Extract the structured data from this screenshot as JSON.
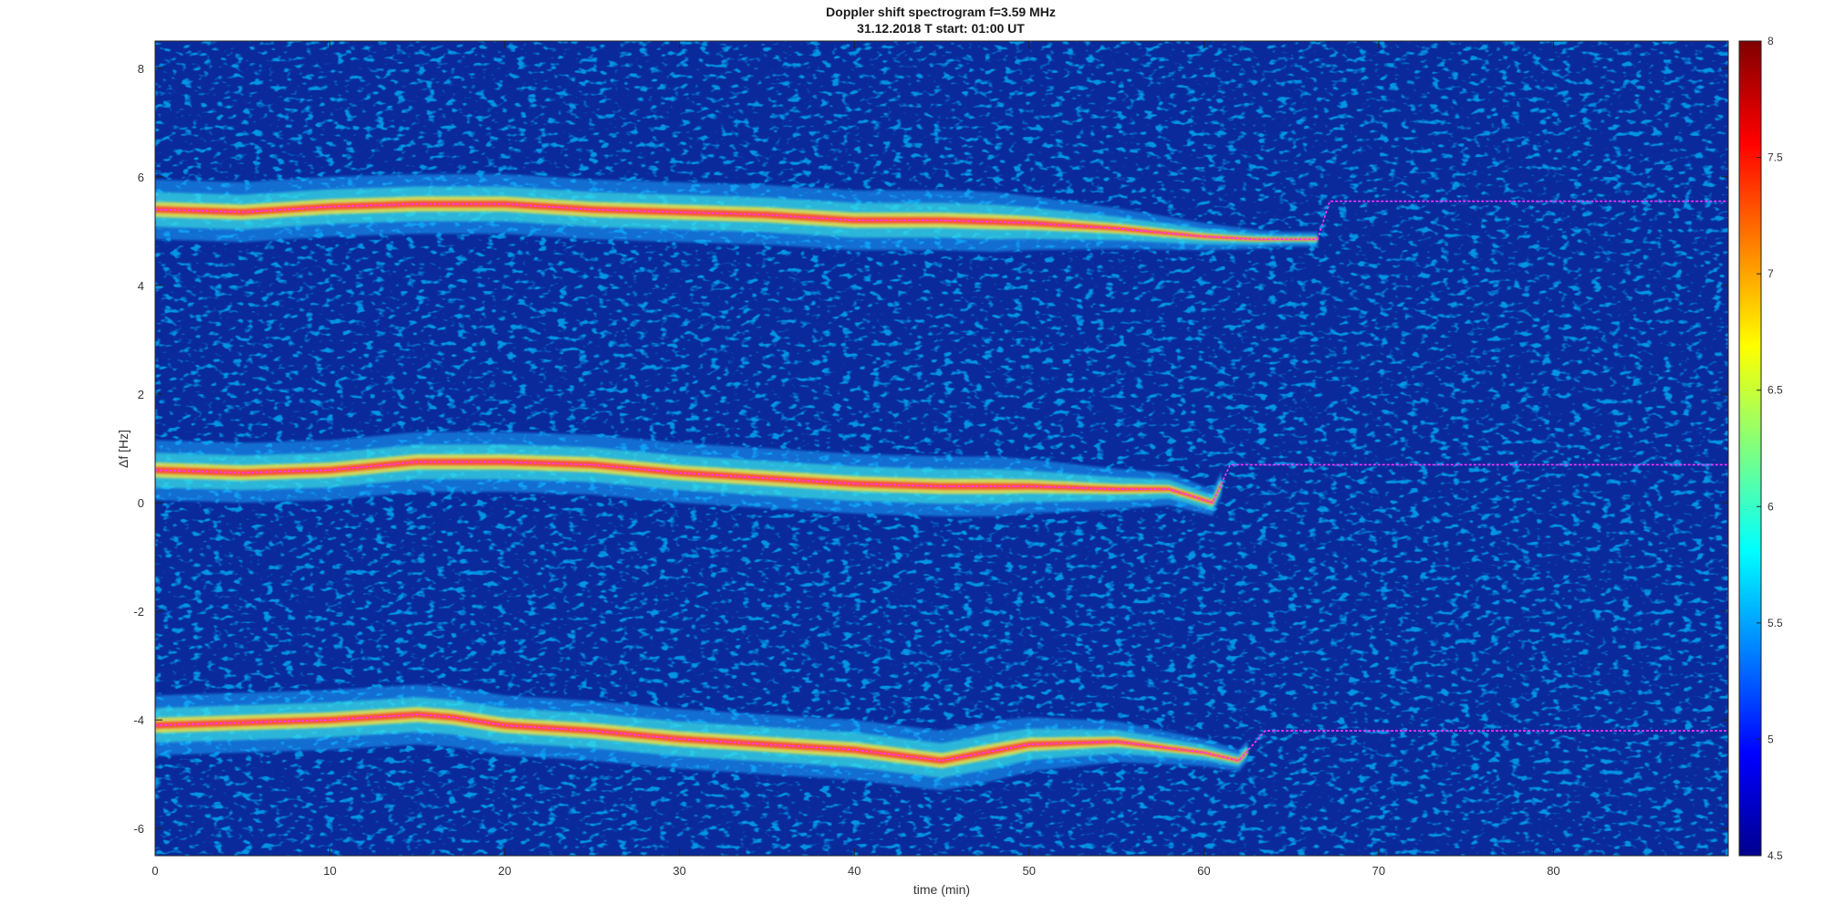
{
  "colors": {
    "background": "#ffffff",
    "plot_background": "#0a2a9c",
    "track_color": "#ff33ff",
    "marker_color": "#000000",
    "colormap": "jet"
  },
  "chart_data": {
    "type": "heatmap",
    "title": "Doppler shift spectrogram f=3.59 MHz",
    "subtitle": "31.12.2018   T start: 01:00 UT",
    "xlabel": "time (min)",
    "ylabel": "Δf [Hz]",
    "xlim": [
      0,
      90
    ],
    "ylim": [
      -6.5,
      8.5
    ],
    "xticks": [
      0,
      10,
      20,
      30,
      40,
      50,
      60,
      70,
      80
    ],
    "yticks": [
      -6,
      -4,
      -2,
      0,
      2,
      4,
      6,
      8
    ],
    "colorbar": {
      "range": [
        4.5,
        8
      ],
      "ticks": [
        4.5,
        5,
        5.5,
        6,
        6.5,
        7,
        7.5,
        8
      ]
    },
    "grid": false,
    "series": [
      {
        "band": "upper",
        "x": [
          0,
          5,
          10,
          15,
          20,
          25,
          30,
          35,
          40,
          45,
          50,
          55,
          60,
          63,
          66.5,
          67.2,
          90
        ],
        "y": [
          5.4,
          5.35,
          5.45,
          5.5,
          5.5,
          5.4,
          5.35,
          5.3,
          5.2,
          5.2,
          5.15,
          5.05,
          4.9,
          4.85,
          4.85,
          5.55,
          5.55
        ]
      },
      {
        "band": "middle",
        "x": [
          0,
          5,
          10,
          15,
          20,
          25,
          30,
          35,
          40,
          45,
          50,
          55,
          58,
          60.5,
          61.5,
          90
        ],
        "y": [
          0.6,
          0.55,
          0.6,
          0.75,
          0.75,
          0.7,
          0.55,
          0.45,
          0.35,
          0.3,
          0.3,
          0.25,
          0.25,
          0.0,
          0.7,
          0.7
        ]
      },
      {
        "band": "lower",
        "x": [
          0,
          5,
          10,
          15,
          17,
          20,
          25,
          30,
          35,
          40,
          45,
          50,
          55,
          60,
          62,
          63.5,
          90
        ],
        "y": [
          -4.1,
          -4.05,
          -4.0,
          -3.9,
          -3.95,
          -4.1,
          -4.2,
          -4.35,
          -4.45,
          -4.55,
          -4.75,
          -4.45,
          -4.4,
          -4.6,
          -4.75,
          -4.2,
          -4.2
        ]
      }
    ]
  }
}
